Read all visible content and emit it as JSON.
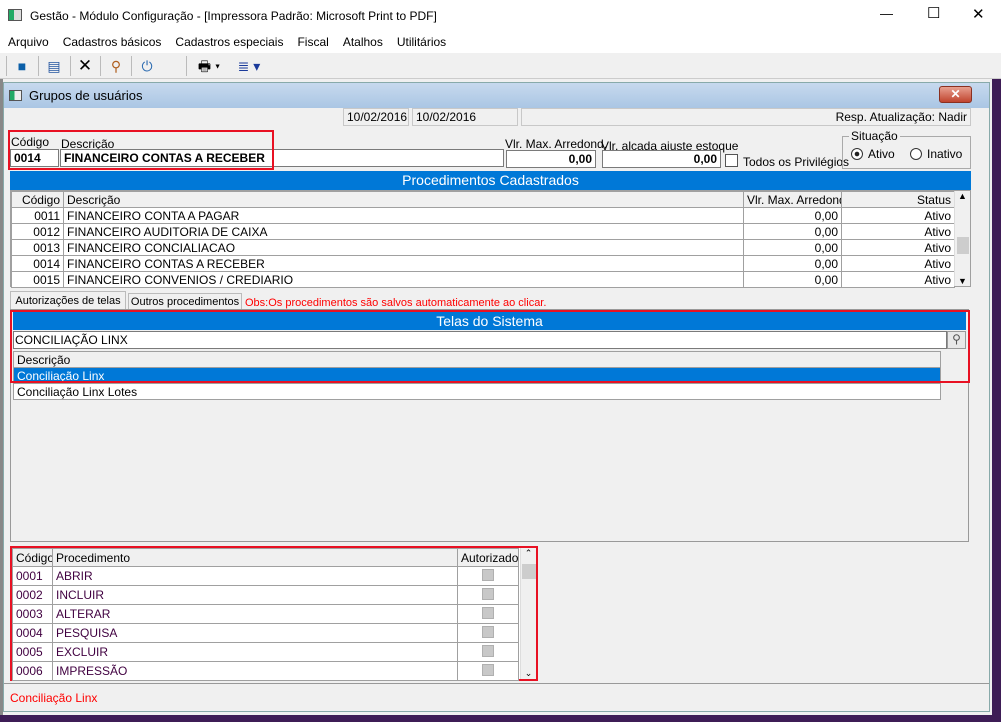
{
  "app": {
    "title": "Gestão  - Módulo Configuração - [Impressora Padrão: Microsoft Print to PDF]",
    "minimize": "—",
    "maximize": "☐",
    "close": "✕"
  },
  "menu": [
    "Arquivo",
    "Cadastros básicos",
    "Cadastros especiais",
    "Fiscal",
    "Atalhos",
    "Utilitários"
  ],
  "toolbar": {
    "icons": [
      "save-icon",
      "new-document-icon",
      "delete-icon",
      "search-icon",
      "power-icon",
      "printer-icon",
      "export-icon"
    ]
  },
  "window": {
    "title": "Grupos de usuários",
    "close": "✕"
  },
  "form": {
    "date1": "10/02/2016",
    "date2": "10/02/2016",
    "resp": "Resp. Atualização: Nadir",
    "codigo_label": "Código",
    "codigo": "0014",
    "descricao_label": "Descrição",
    "descricao": "FINANCEIRO CONTAS A RECEBER",
    "vlr_max_label": "Vlr. Max. Arredond.",
    "vlr_max": "0,00",
    "vlr_alcada_label": "Vlr. alçada ajuste estoque",
    "vlr_alcada": "0,00",
    "todos_label": "Todos os Privilégios",
    "todos_checked": false,
    "situacao_label": "Situação",
    "ativo": "Ativo",
    "inativo": "Inativo",
    "situacao_value": "Ativo"
  },
  "procedimentos": {
    "title": "Procedimentos Cadastrados",
    "columns": [
      "Código",
      "Descrição",
      "Vlr. Max. Arredond.",
      "Status"
    ],
    "rows": [
      [
        "0011",
        "FINANCEIRO CONTA A PAGAR",
        "0,00",
        "Ativo"
      ],
      [
        "0012",
        "FINANCEIRO AUDITORIA DE CAIXA",
        "0,00",
        "Ativo"
      ],
      [
        "0013",
        "FINANCEIRO CONCIALIACAO",
        "0,00",
        "Ativo"
      ],
      [
        "0014",
        "FINANCEIRO CONTAS A RECEBER",
        "0,00",
        "Ativo"
      ],
      [
        "0015",
        "FINANCEIRO CONVENIOS / CREDIARIO",
        "0,00",
        "Ativo"
      ]
    ]
  },
  "tabs": [
    "Autorizações de telas",
    "Outros procedimentos"
  ],
  "obs": "Obs:Os procedimentos são salvos automaticamente ao clicar.",
  "telas": {
    "title": "Telas do Sistema",
    "search": "CONCILIAÇÃO LINX",
    "column": "Descrição",
    "rows": [
      "Conciliação Linx",
      "Conciliação Linx Lotes"
    ],
    "selected": 0
  },
  "autorizacoes": {
    "columns": [
      "Código",
      "Procedimento",
      "Autorizado"
    ],
    "rows": [
      [
        "0001",
        "ABRIR"
      ],
      [
        "0002",
        "INCLUIR"
      ],
      [
        "0003",
        "ALTERAR"
      ],
      [
        "0004",
        "PESQUISA"
      ],
      [
        "0005",
        "EXCLUIR"
      ],
      [
        "0006",
        "IMPRESSÃO"
      ]
    ]
  },
  "status": "Conciliação Linx",
  "colors": {
    "accent": "#0078d7",
    "highlight": "#e81123",
    "status_text": "#ff0000"
  }
}
